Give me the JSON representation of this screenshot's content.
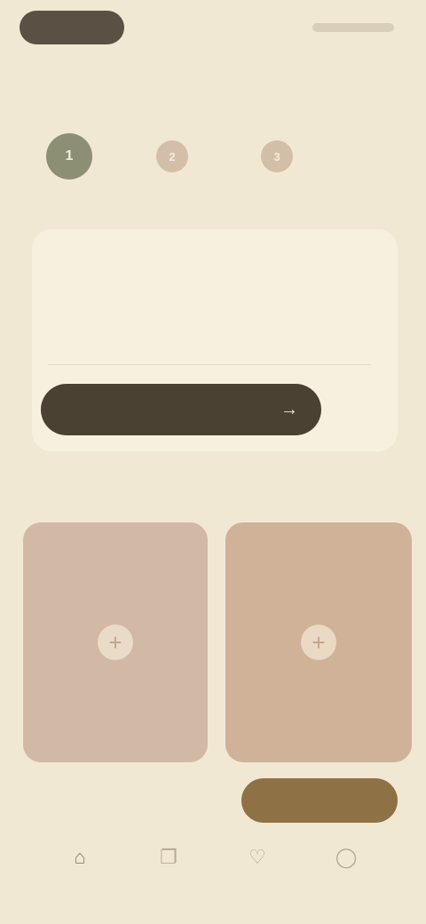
{
  "status": {
    "pill_label": "",
    "right_label": ""
  },
  "header": {
    "title": ""
  },
  "steps": [
    {
      "number": "1",
      "label": "",
      "state": "active"
    },
    {
      "number": "2",
      "label": "",
      "state": "inactive"
    },
    {
      "number": "3",
      "label": "",
      "state": "inactive"
    }
  ],
  "card": {
    "eyebrow": "",
    "question": "",
    "cta_label": "",
    "cta_arrow": "→",
    "skip_label": ""
  },
  "section": {
    "title": "",
    "more_label": ""
  },
  "tiles": [
    {
      "plus": "+"
    },
    {
      "plus": "+"
    }
  ],
  "tile_caption": "",
  "fab_label": "",
  "nav": [
    {
      "icon": "home-icon",
      "glyph": "⌂",
      "label": ""
    },
    {
      "icon": "bookmark-icon",
      "glyph": "❐",
      "label": ""
    },
    {
      "icon": "heart-icon",
      "glyph": "♡",
      "label": ""
    },
    {
      "icon": "profile-icon",
      "glyph": "◯",
      "label": ""
    }
  ],
  "colors": {
    "background": "#f1e8d4",
    "primary": "#4a4133",
    "accent_green": "#8d8f74",
    "accent_gold": "#8f7146",
    "tile": "#d2b9a5"
  }
}
